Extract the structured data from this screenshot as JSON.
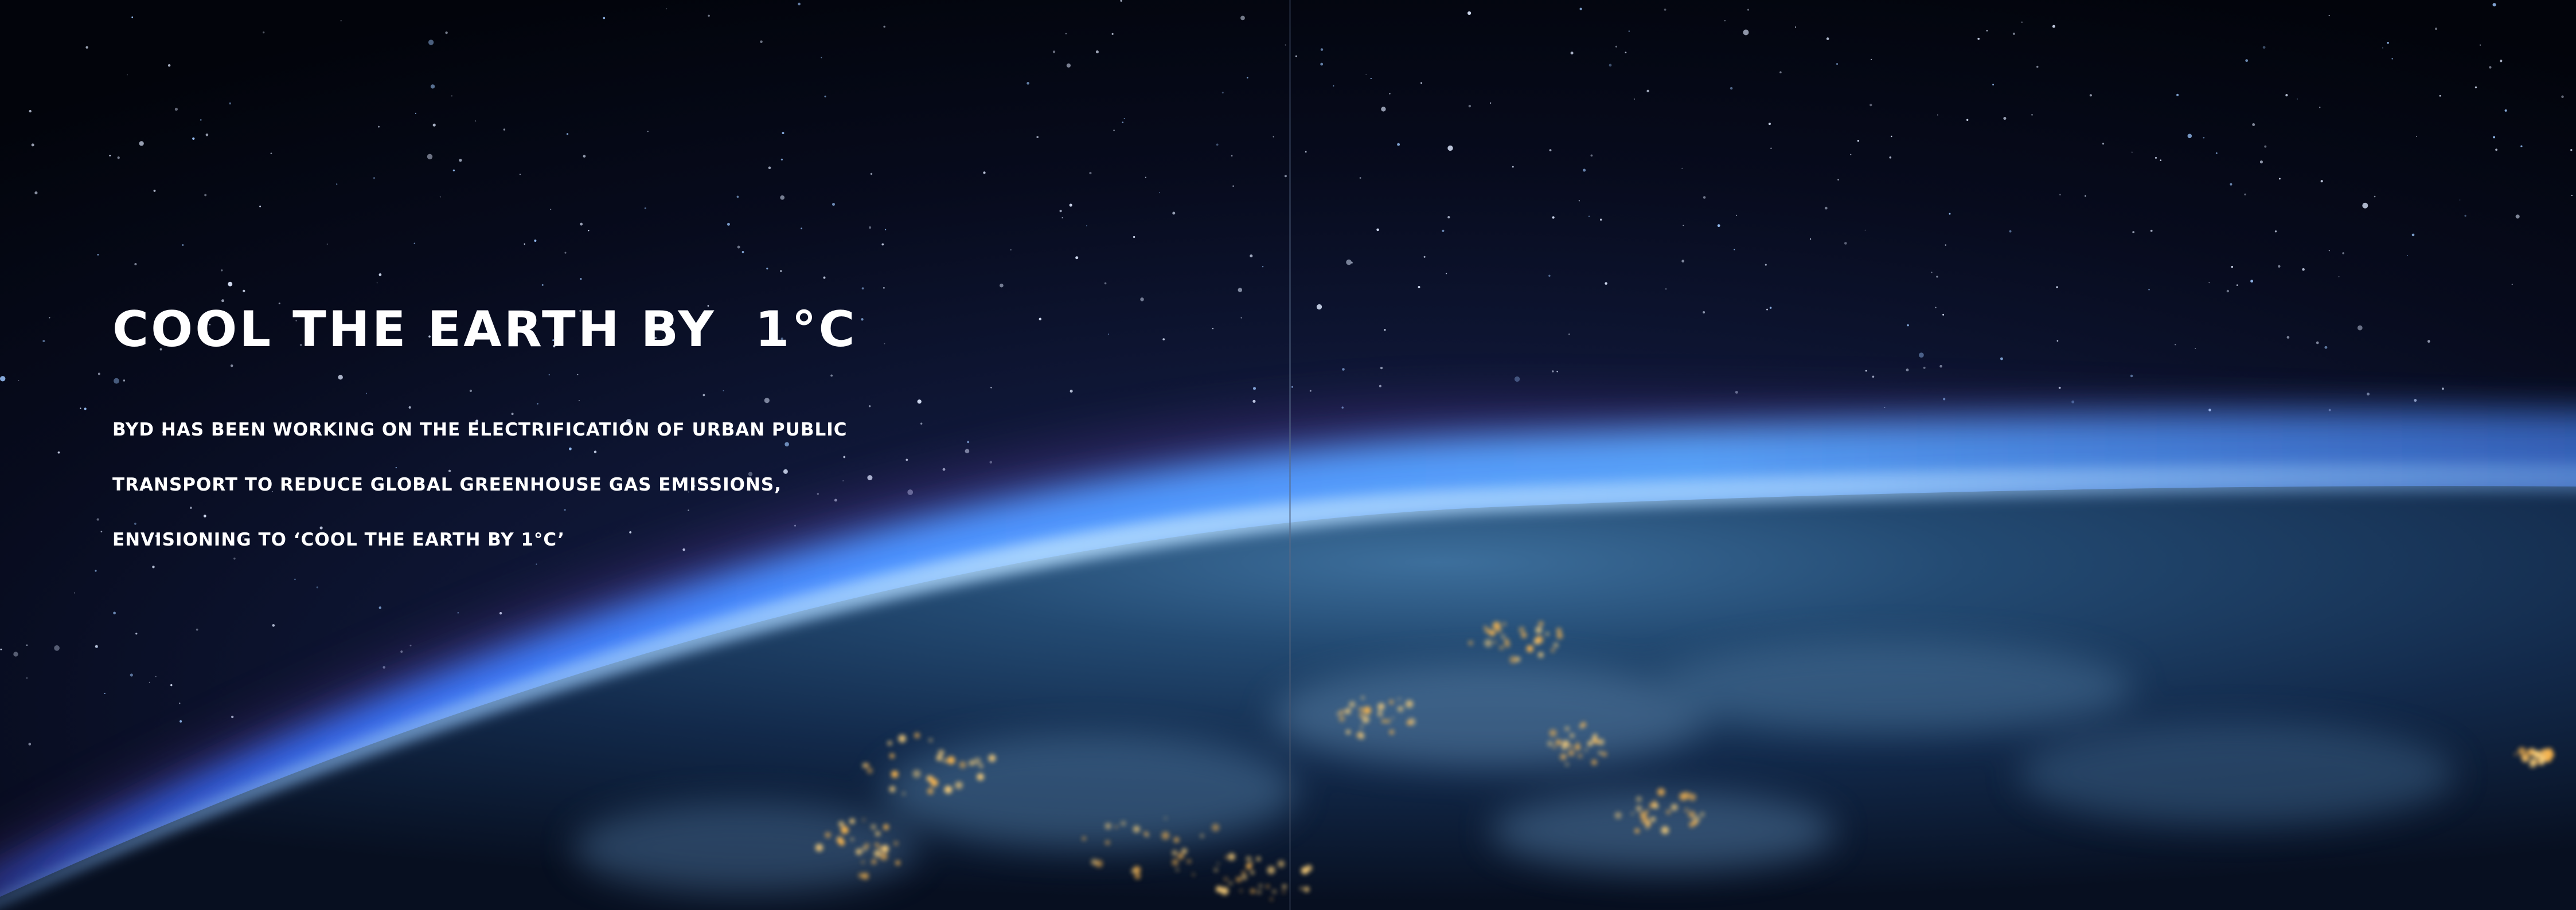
{
  "colors": {
    "space": "#02050c",
    "atmosphere_glow": "#3f86ff",
    "atmosphere_haze": "#9fd2ff",
    "earth_surface": "#173456",
    "city_lights": "#ffd27a",
    "text": "#ffffff"
  },
  "headline": "COOL THE EARTH BY  1°C",
  "body": [
    "BYD HAS BEEN WORKING ON THE ELECTRIFICATION OF URBAN PUBLIC",
    "TRANSPORT TO REDUCE GLOBAL GREENHOUSE GAS EMISSIONS,",
    "ENVISIONING TO ‘COOL THE EARTH BY 1°C’"
  ]
}
